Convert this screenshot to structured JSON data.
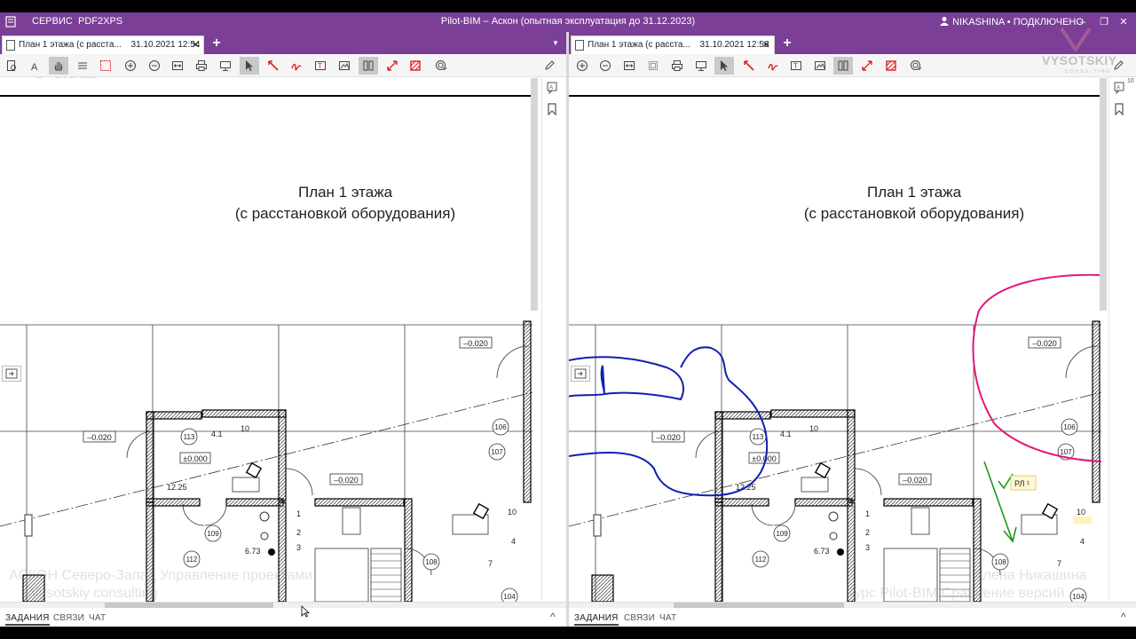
{
  "window": {
    "title": "Pilot-BIM – Аскон (опытная эксплуатация до 31.12.2023)",
    "menu": [
      "СЕРВИС",
      "PDF2XPS"
    ],
    "user_status": "NIKASHINA • ПОДКЛЮЧЕНО",
    "controls": [
      "–",
      "❐",
      "✕"
    ]
  },
  "colors": {
    "accent": "#7b3f97",
    "annotation_blue": "#1020b0",
    "annotation_magenta": "#e0187a",
    "annotation_green": "#1a9a1a",
    "annotation_red": "#e02020"
  },
  "left_pane": {
    "tab": {
      "label": "План 1 этажа (с расста...",
      "date": "31.10.2021 12:54",
      "close": "✕"
    },
    "add_tab": "+",
    "drawing": {
      "title_line1": "План 1 этажа",
      "title_line2": "(с расстановкой оборудования)",
      "level_marks": [
        "–0.020",
        "–0.020",
        "–0.020"
      ],
      "floor_mark": "±0.000",
      "room_numbers": [
        "113",
        "109",
        "112",
        "108",
        "106",
        "107",
        "104"
      ],
      "equipment_labels": [
        "4.1",
        "10",
        "1",
        "2",
        "3",
        "10",
        "4",
        "7"
      ],
      "area_labels": [
        "12.25",
        "6.73"
      ]
    },
    "bottom_tabs": [
      "ЗАДАНИЯ",
      "СВЯЗИ",
      "ЧАТ"
    ],
    "watermark_lines": [
      "АСКОН Северо-Запад Управление проектами",
      "Vysotskiy consulting"
    ]
  },
  "right_pane": {
    "tab": {
      "label": "План 1 этажа (с расста...",
      "date": "31.10.2021 12:56",
      "close": "✕"
    },
    "add_tab": "+",
    "drawing": {
      "title_line1": "План 1 этажа",
      "title_line2": "(с расстановкой оборудования)",
      "level_marks": [
        "–0.020",
        "–0.020",
        "–0.020"
      ],
      "floor_mark": "±0.000",
      "room_numbers": [
        "113",
        "109",
        "112",
        "108",
        "106",
        "107",
        "104"
      ],
      "equipment_labels": [
        "4.1",
        "10",
        "1",
        "2",
        "3",
        "10",
        "4",
        "7"
      ],
      "area_labels": [
        "12.25",
        "6.73"
      ],
      "remark_tag": "РЛ ¹"
    },
    "bottom_tabs": [
      "ЗАДАНИЯ",
      "СВЯЗИ",
      "ЧАТ"
    ],
    "watermark_lines": [
      "Алена Никашина",
      "Курс Pilot-BIM Сравнение версий"
    ],
    "side_badge": "10"
  },
  "branding": {
    "logo_text": "VYSOTSKIY",
    "logo_sub": "CONSULTING"
  },
  "toolbar_icons": [
    "zoom-in-icon",
    "zoom-out-icon",
    "fit-width-icon",
    "fit-page-icon",
    "print-icon",
    "monitor-icon",
    "pointer-icon",
    "arrow-remark-icon",
    "freehand-remark-icon",
    "text-remark-icon",
    "image-remark-icon",
    "bookmark-icon",
    "resize-icon",
    "hatch-icon",
    "stamp-icon",
    "pen-icon"
  ]
}
